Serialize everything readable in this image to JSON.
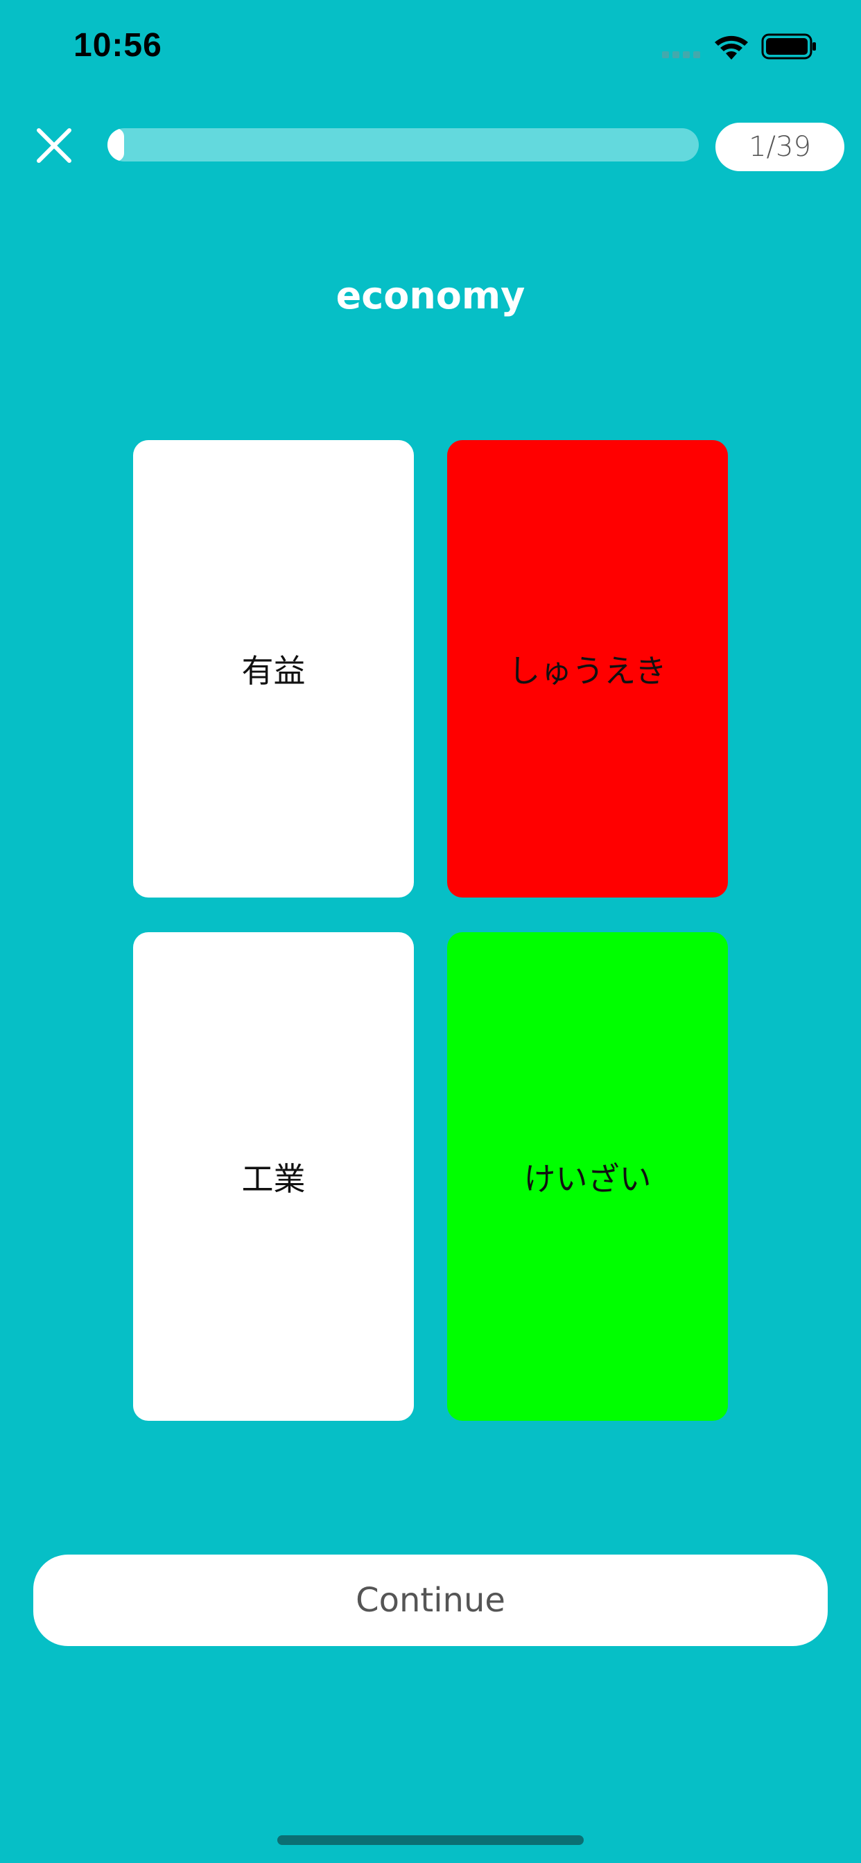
{
  "status_bar": {
    "time": "10:56",
    "icons": [
      "cellular-signal-icon",
      "wifi-icon",
      "battery-icon"
    ]
  },
  "header": {
    "close_icon": "close-icon",
    "progress_fraction": 0.025,
    "counter": "1/39"
  },
  "prompt": {
    "word": "economy"
  },
  "cards": [
    {
      "label": "有益",
      "state": "default",
      "color": "#ffffff"
    },
    {
      "label": "しゅうえき",
      "state": "incorrect",
      "color": "#ff0000"
    },
    {
      "label": "工業",
      "state": "default",
      "color": "#ffffff"
    },
    {
      "label": "けいざい",
      "state": "correct",
      "color": "#00ff00"
    }
  ],
  "footer": {
    "continue_label": "Continue"
  },
  "colors": {
    "background": "#06bfc6",
    "progress_track": "#63d9dd",
    "incorrect": "#ff0000",
    "correct": "#00ff00"
  }
}
